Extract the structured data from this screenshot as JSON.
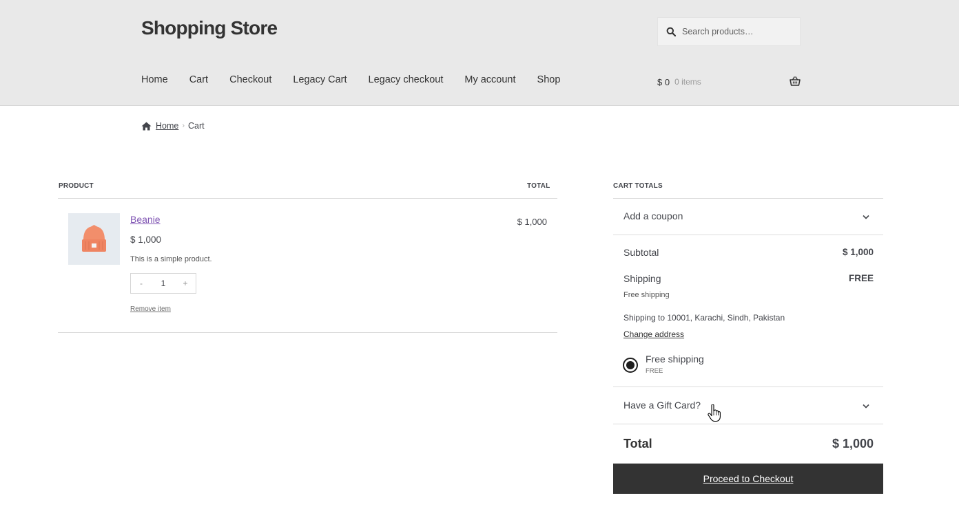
{
  "header": {
    "site_title": "Shopping Store",
    "search_placeholder": "Search products…",
    "nav": [
      "Home",
      "Cart",
      "Checkout",
      "Legacy Cart",
      "Legacy checkout",
      "My account",
      "Shop"
    ],
    "mini_cart": {
      "amount": "$ 0",
      "count": "0 items"
    }
  },
  "breadcrumb": {
    "home": "Home",
    "current": "Cart"
  },
  "cart_table": {
    "headers": {
      "product": "PRODUCT",
      "total": "TOTAL"
    },
    "items": [
      {
        "name": "Beanie",
        "price": "$ 1,000",
        "description": "This is a simple product.",
        "quantity": "1",
        "qty_minus": "-",
        "qty_plus": "+",
        "remove_label": "Remove item",
        "line_total": "$ 1,000"
      }
    ]
  },
  "totals": {
    "heading": "CART TOTALS",
    "coupon_label": "Add a coupon",
    "subtotal_label": "Subtotal",
    "subtotal_value": "$ 1,000",
    "shipping_label": "Shipping",
    "shipping_value": "FREE",
    "shipping_method_note": "Free shipping",
    "shipping_address": "Shipping to 10001, Karachi, Sindh, Pakistan",
    "change_address": "Change address",
    "shipping_option": {
      "label": "Free shipping",
      "price": "FREE",
      "selected": true
    },
    "gift_card_label": "Have a Gift Card?",
    "total_label": "Total",
    "total_value": "$ 1,000",
    "checkout_button": "Proceed to Checkout"
  },
  "colors": {
    "header_bg": "#e9e9e9",
    "product_link": "#7f54b3",
    "checkout_button_bg": "#333333",
    "product_image_accent": "#f28e6b"
  },
  "icons": [
    "search-icon",
    "basket-icon",
    "home-icon",
    "chevron-down-icon",
    "hand-pointer-cursor"
  ]
}
